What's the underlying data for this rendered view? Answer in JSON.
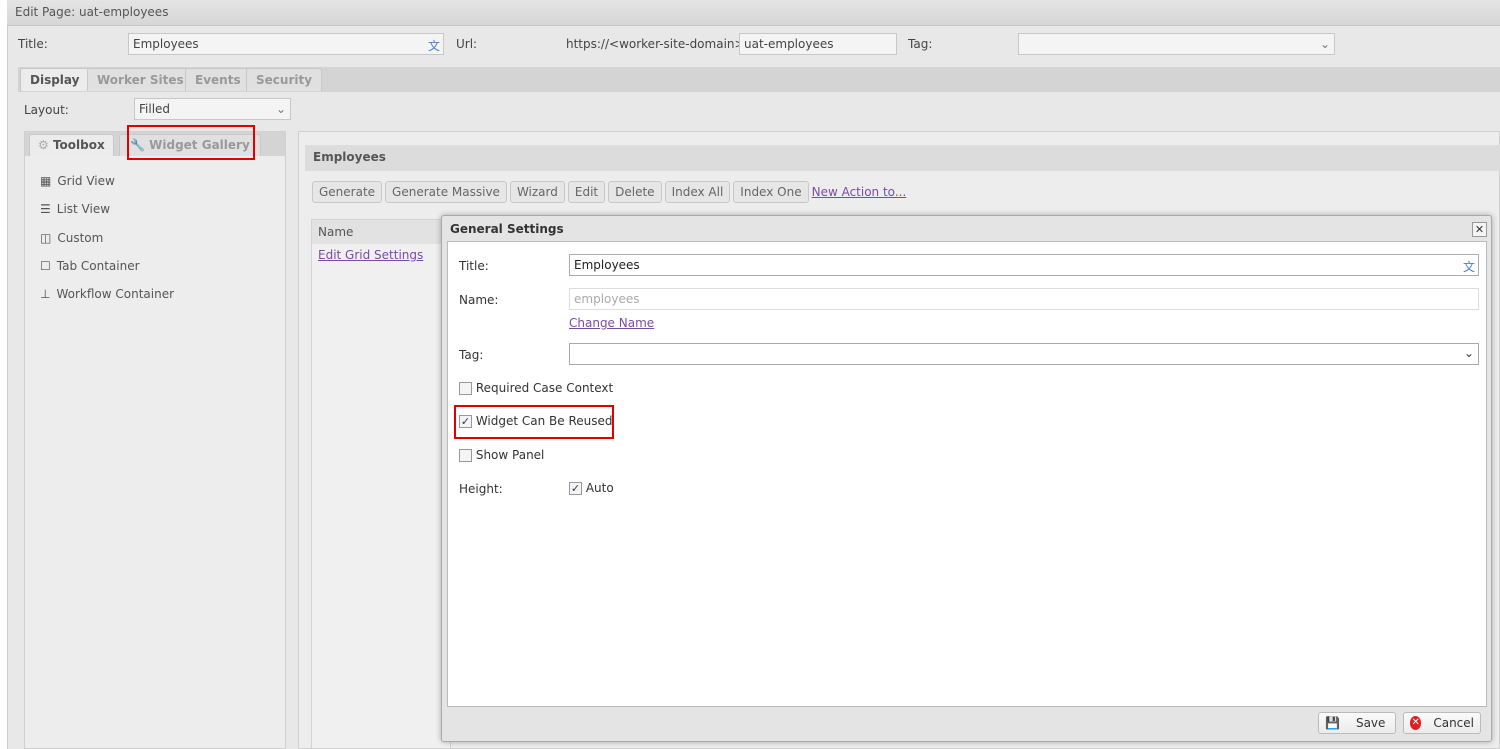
{
  "window": {
    "title": "Edit Page: uat-employees"
  },
  "header": {
    "title_label": "Title:",
    "title_value": "Employees",
    "url_label": "Url:",
    "url_prefix": "https://<worker-site-domain>/",
    "url_value": "uat-employees",
    "tag_label": "Tag:",
    "tag_value": ""
  },
  "tabs": [
    {
      "label": "Display"
    },
    {
      "label": "Worker Sites"
    },
    {
      "label": "Events"
    },
    {
      "label": "Security"
    }
  ],
  "layout": {
    "label": "Layout:",
    "value": "Filled"
  },
  "side_tabs": [
    {
      "label": "Toolbox"
    },
    {
      "label": "Widget Gallery"
    }
  ],
  "toolbox": [
    {
      "label": "Grid View"
    },
    {
      "label": "List View"
    },
    {
      "label": "Custom"
    },
    {
      "label": "Tab Container"
    },
    {
      "label": "Workflow Container"
    }
  ],
  "panel": {
    "title": "Employees",
    "actions": [
      "Generate",
      "Generate Massive",
      "Wizard",
      "Edit",
      "Delete",
      "Index All",
      "Index One"
    ],
    "new_action": "New Action to...",
    "column": "Name",
    "row_link": "Edit Grid Settings"
  },
  "dialog": {
    "title": "General Settings",
    "title_label": "Title:",
    "title_value": "Employees",
    "name_label": "Name:",
    "name_placeholder": "employees",
    "change_name": "Change Name",
    "tag_label": "Tag:",
    "tag_value": "",
    "required_case": "Required Case Context",
    "required_case_checked": false,
    "reusable": "Widget Can Be Reused",
    "reusable_checked": true,
    "show_panel": "Show Panel",
    "show_panel_checked": false,
    "height_label": "Height:",
    "auto": "Auto",
    "auto_checked": true,
    "save": "Save",
    "cancel": "Cancel"
  },
  "colors": {
    "highlight": "#e00000",
    "link": "#7a4ba5"
  }
}
